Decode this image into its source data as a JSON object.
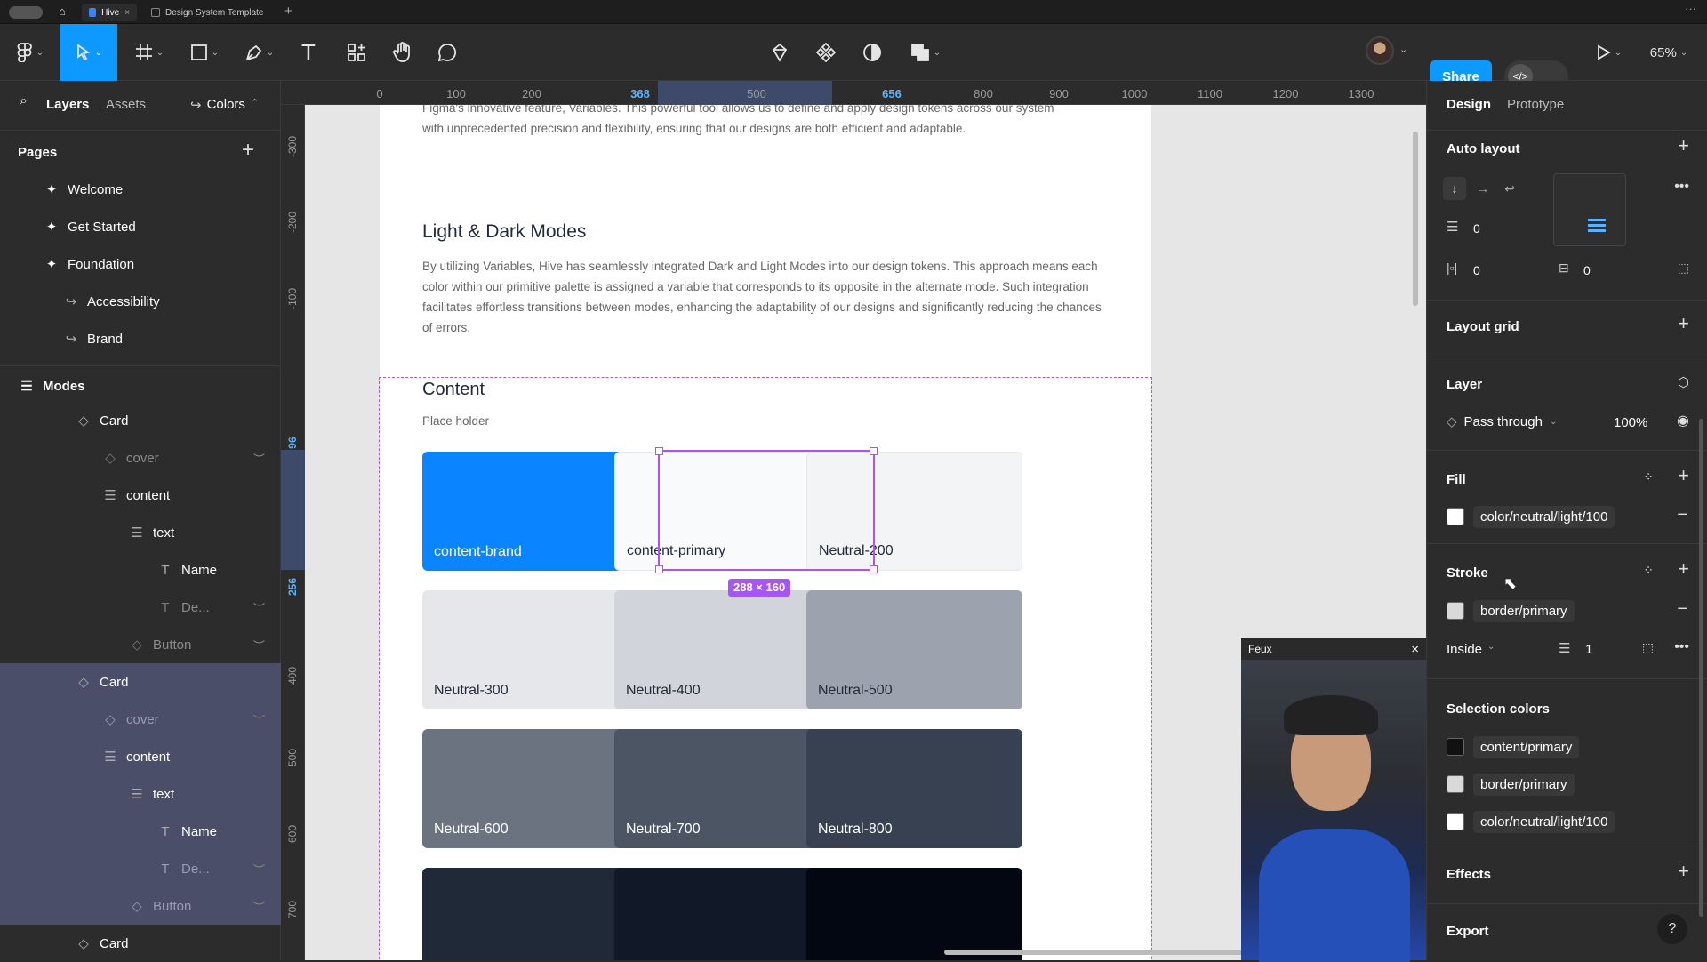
{
  "tabs": [
    {
      "label": "Hive"
    },
    {
      "label": "Design System Template"
    }
  ],
  "toolbar": {
    "share_label": "Share",
    "zoom": "65%"
  },
  "left_panel": {
    "tabs": {
      "layers": "Layers",
      "assets": "Assets",
      "colors": "Colors"
    },
    "pages_title": "Pages",
    "pages": [
      {
        "label": "Welcome"
      },
      {
        "label": "Get Started"
      },
      {
        "label": "Foundation"
      },
      {
        "label": "Accessibility"
      },
      {
        "label": "Brand"
      }
    ],
    "modes_title": "Modes",
    "layers": [
      {
        "label": "Card"
      },
      {
        "label": "cover"
      },
      {
        "label": "content"
      },
      {
        "label": "text"
      },
      {
        "label": "Name"
      },
      {
        "label": "De..."
      },
      {
        "label": "Button"
      },
      {
        "label": "Card"
      },
      {
        "label": "cover"
      },
      {
        "label": "content"
      },
      {
        "label": "text"
      },
      {
        "label": "Name"
      },
      {
        "label": "De..."
      },
      {
        "label": "Button"
      },
      {
        "label": "Card"
      }
    ]
  },
  "rulers": {
    "top": [
      "0",
      "100",
      "200",
      "368",
      "500",
      "656",
      "800",
      "900",
      "1000",
      "1100",
      "1200",
      "1300"
    ],
    "left": [
      "-300",
      "-200",
      "-100",
      "96",
      "256",
      "400",
      "500",
      "600",
      "700"
    ]
  },
  "canvas": {
    "intro_line1": "Figma's innovative feature, Variables. This powerful tool allows us to define and apply design tokens across our system",
    "intro_line2": "with unprecedented precision and flexibility, ensuring that our designs are both efficient and adaptable.",
    "section_title": "Light & Dark Modes",
    "section_body": "By utilizing Variables, Hive has seamlessly integrated Dark and Light Modes into our design tokens. This approach means each color within our primitive palette is assigned a variable that corresponds to its opposite in the alternate mode. Such integration facilitates effortless transitions between modes, enhancing the adaptability of our designs and significantly reducing the chances of errors.",
    "content_title": "Content",
    "content_sub": "Place holder",
    "size_badge": "288 × 160",
    "cards": [
      {
        "label": "content-brand",
        "color": "#0a84ff",
        "text": "#ffffff"
      },
      {
        "label": "content-primary",
        "color": "#f9fafb",
        "text": "#1f2937"
      },
      {
        "label": "Neutral-200",
        "color": "#f3f4f6",
        "text": "#1f2937"
      },
      {
        "label": "Neutral-300",
        "color": "#e5e7eb",
        "text": "#1f2937"
      },
      {
        "label": "Neutral-400",
        "color": "#d1d5db",
        "text": "#1f2937"
      },
      {
        "label": "Neutral-500",
        "color": "#9ca3af",
        "text": "#1f2937"
      },
      {
        "label": "Neutral-600",
        "color": "#6b7280",
        "text": "#ffffff"
      },
      {
        "label": "Neutral-700",
        "color": "#4b5563",
        "text": "#ffffff"
      },
      {
        "label": "Neutral-800",
        "color": "#374151",
        "text": "#ffffff"
      },
      {
        "label": "",
        "color": "#1f2937",
        "text": "#ffffff"
      },
      {
        "label": "",
        "color": "#111827",
        "text": "#ffffff"
      },
      {
        "label": "",
        "color": "#030712",
        "text": "#ffffff"
      }
    ]
  },
  "video": {
    "title": "Feux"
  },
  "right_panel": {
    "tabs": {
      "design": "Design",
      "prototype": "Prototype"
    },
    "auto_layout": {
      "title": "Auto layout",
      "gap": "0",
      "pad_h": "0",
      "pad_v": "0"
    },
    "layout_grid": "Layout grid",
    "layer": {
      "title": "Layer",
      "blend": "Pass through",
      "opacity": "100%"
    },
    "fill": {
      "title": "Fill",
      "value": "color/neutral/light/100"
    },
    "stroke": {
      "title": "Stroke",
      "value": "border/primary",
      "position": "Inside",
      "weight": "1"
    },
    "selection_colors": {
      "title": "Selection colors",
      "items": [
        {
          "label": "content/primary",
          "color": "#111111"
        },
        {
          "label": "border/primary",
          "color": "#d9d9d9"
        },
        {
          "label": "color/neutral/light/100",
          "color": "#ffffff"
        }
      ]
    },
    "effects": "Effects",
    "export": "Export"
  }
}
